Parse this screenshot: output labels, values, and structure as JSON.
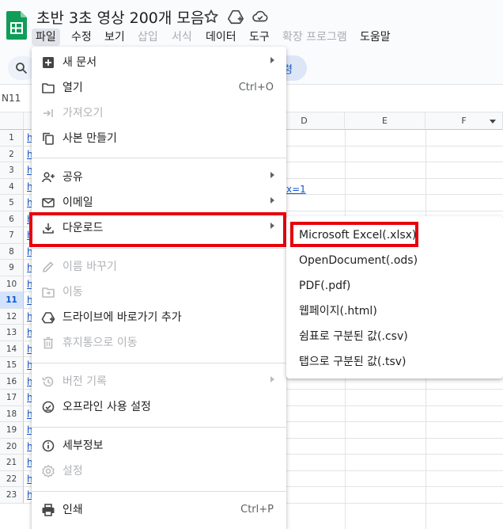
{
  "app": {
    "title": "초반 3초 영상 200개 모음"
  },
  "menubar": [
    {
      "label": "파일",
      "active": true,
      "disabled": false
    },
    {
      "label": "수정",
      "active": false,
      "disabled": false
    },
    {
      "label": "보기",
      "active": false,
      "disabled": false
    },
    {
      "label": "삽입",
      "active": false,
      "disabled": true
    },
    {
      "label": "서식",
      "active": false,
      "disabled": true
    },
    {
      "label": "데이터",
      "active": false,
      "disabled": false
    },
    {
      "label": "도구",
      "active": false,
      "disabled": false
    },
    {
      "label": "확장 프로그램",
      "active": false,
      "disabled": true
    },
    {
      "label": "도움말",
      "active": false,
      "disabled": false
    }
  ],
  "toolbar": {
    "pill_text": "령"
  },
  "formula_bar": {
    "name_box": "N11"
  },
  "grid": {
    "columns": [
      "D",
      "E",
      "F"
    ],
    "rows": [
      "1",
      "2",
      "3",
      "4",
      "5",
      "6",
      "7",
      "8",
      "9",
      "10",
      "11",
      "12",
      "13",
      "14",
      "15",
      "16",
      "17",
      "18",
      "19",
      "20",
      "21",
      "22",
      "23"
    ],
    "selected_row": "11",
    "link_glyph": "h",
    "visible_fragment": "x=1"
  },
  "file_menu": {
    "items": [
      {
        "label": "새 문서",
        "icon": "plus-square-icon",
        "shortcut": "",
        "submenu": true,
        "disabled": false
      },
      {
        "label": "열기",
        "icon": "folder-icon",
        "shortcut": "Ctrl+O",
        "submenu": false,
        "disabled": false
      },
      {
        "label": "가져오기",
        "icon": "import-icon",
        "shortcut": "",
        "submenu": false,
        "disabled": true
      },
      {
        "label": "사본 만들기",
        "icon": "copy-icon",
        "shortcut": "",
        "submenu": false,
        "disabled": false
      },
      {
        "label": "공유",
        "icon": "person-add-icon",
        "shortcut": "",
        "submenu": true,
        "disabled": false
      },
      {
        "label": "이메일",
        "icon": "mail-icon",
        "shortcut": "",
        "submenu": true,
        "disabled": false
      },
      {
        "label": "다운로드",
        "icon": "download-icon",
        "shortcut": "",
        "submenu": true,
        "disabled": false
      },
      {
        "label": "이름 바꾸기",
        "icon": "pencil-icon",
        "shortcut": "",
        "submenu": false,
        "disabled": true
      },
      {
        "label": "이동",
        "icon": "folder-move-icon",
        "shortcut": "",
        "submenu": false,
        "disabled": true
      },
      {
        "label": "드라이브에 바로가기 추가",
        "icon": "drive-add-icon",
        "shortcut": "",
        "submenu": false,
        "disabled": false
      },
      {
        "label": "휴지통으로 이동",
        "icon": "trash-icon",
        "shortcut": "",
        "submenu": false,
        "disabled": true
      },
      {
        "label": "버전 기록",
        "icon": "history-icon",
        "shortcut": "",
        "submenu": true,
        "disabled": true
      },
      {
        "label": "오프라인 사용 설정",
        "icon": "offline-check-icon",
        "shortcut": "",
        "submenu": false,
        "disabled": false
      },
      {
        "label": "세부정보",
        "icon": "info-icon",
        "shortcut": "",
        "submenu": false,
        "disabled": false
      },
      {
        "label": "설정",
        "icon": "gear-icon",
        "shortcut": "",
        "submenu": false,
        "disabled": true
      },
      {
        "label": "인쇄",
        "icon": "printer-icon",
        "shortcut": "Ctrl+P",
        "submenu": false,
        "disabled": false
      }
    ]
  },
  "download_menu": {
    "items": [
      {
        "label": "Microsoft Excel(.xlsx)"
      },
      {
        "label": "OpenDocument(.ods)"
      },
      {
        "label": "PDF(.pdf)"
      },
      {
        "label": "웹페이지(.html)"
      },
      {
        "label": "쉼표로 구분된 값(.csv)"
      },
      {
        "label": "탭으로 구분된 값(.tsv)"
      }
    ]
  },
  "colors": {
    "highlight_box": "#e8000b",
    "link": "#1155cc",
    "sheets_green": "#0f9d58"
  }
}
